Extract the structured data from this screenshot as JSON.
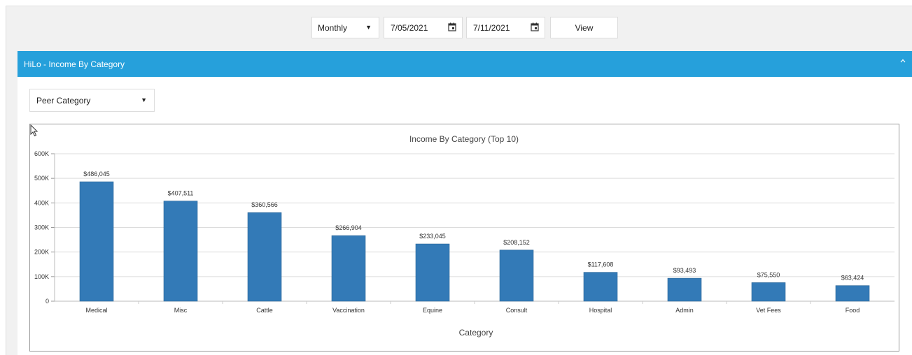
{
  "toolbar": {
    "period_value": "Monthly",
    "date_from": "7/05/2021",
    "date_to": "7/11/2021",
    "view_label": "View",
    "icons": [
      "chevron-down-icon",
      "calendar-icon",
      "calendar-icon"
    ]
  },
  "panel": {
    "title": "HiLo - Income By Category",
    "header_color": "#26a0db",
    "collapse_icon": "chevron-up-icon"
  },
  "filter": {
    "category_value": "Peer Category"
  },
  "chart_data": {
    "type": "bar",
    "title": "Income By Category (Top 10)",
    "xlabel": "Category",
    "ylabel": "",
    "ylim": [
      0,
      600000
    ],
    "yticks": [
      0,
      100000,
      200000,
      300000,
      400000,
      500000,
      600000
    ],
    "ytick_labels": [
      "0",
      "100K",
      "200K",
      "300K",
      "400K",
      "500K",
      "600K"
    ],
    "categories": [
      "Medical",
      "Misc",
      "Cattle",
      "Vaccination",
      "Equine",
      "Consult",
      "Hospital",
      "Admin",
      "Vet Fees",
      "Food"
    ],
    "values": [
      486045,
      407511,
      360566,
      266904,
      233045,
      208152,
      117608,
      93493,
      75550,
      63424
    ],
    "data_labels": [
      "$486,045",
      "$407,511",
      "$360,566",
      "$266,904",
      "$233,045",
      "$208,152",
      "$117,608",
      "$93,493",
      "$75,550",
      "$63,424"
    ],
    "bar_color": "#337ab7",
    "grid": true,
    "legend": "none"
  }
}
